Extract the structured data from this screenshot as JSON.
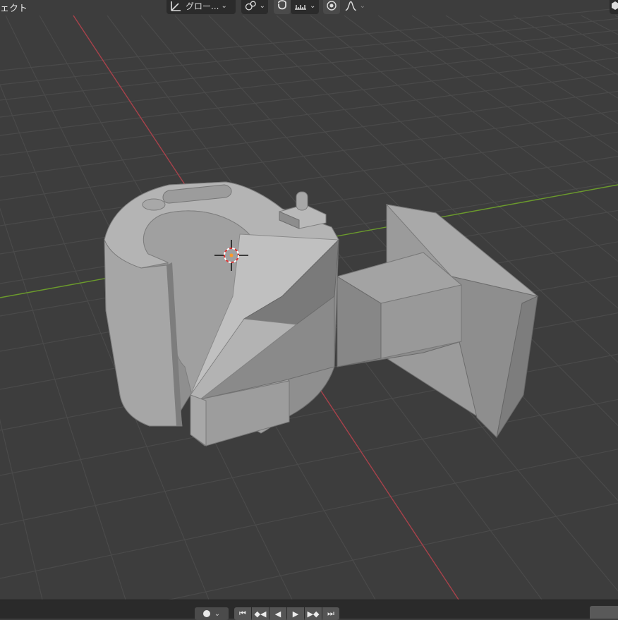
{
  "header": {
    "left_label": "ェクト",
    "transform_orientation": "グロー...",
    "icons": {
      "orientation": "transform-orientation-icon",
      "pivot": "pivot-point-icon",
      "snap": "snap-magnet-icon",
      "snap_target": "snap-increment-icon",
      "proportional": "proportional-editing-icon",
      "falloff": "falloff-curve-icon"
    }
  },
  "viewport": {
    "colors": {
      "background": "#3d3d3d",
      "grid": "#4a4a4a",
      "x_axis": "#a8414a",
      "y_axis": "#6b9a2c",
      "mesh": "#9a9a9a"
    }
  },
  "timeline": {
    "keyframe_icon": "keyframe-dot-icon",
    "jump_start": "⏮",
    "prev_keyframe": "◆◀",
    "play_reverse": "◀",
    "play": "▶",
    "next_keyframe": "▶◆",
    "jump_end": "⏭"
  }
}
